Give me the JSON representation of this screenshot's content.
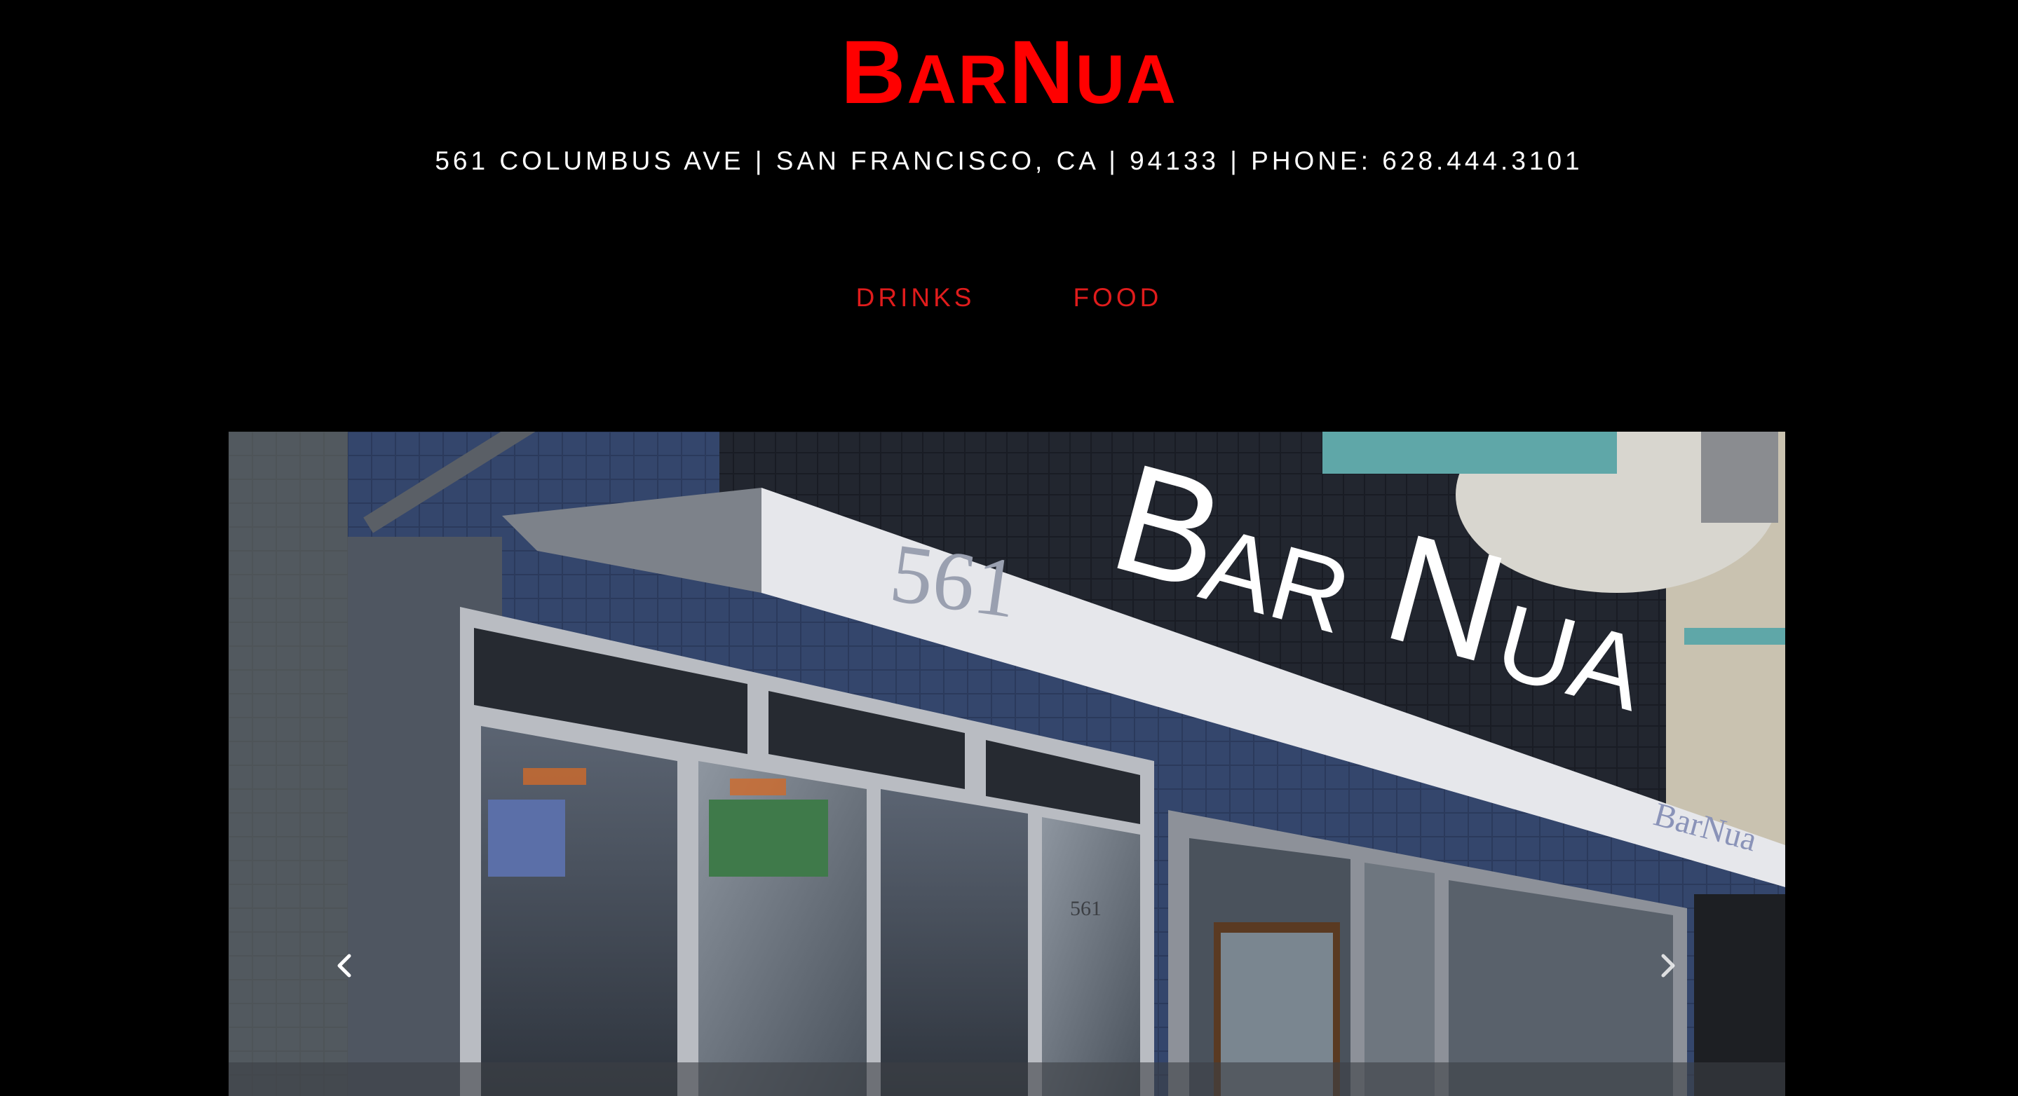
{
  "site": {
    "logo_first_big": "B",
    "logo_first_small": "AR",
    "logo_second_big": "N",
    "logo_second_small": "UA",
    "address": "561 COLUMBUS AVE | SAN FRANCISCO, CA | 94133 | PHONE: 628.444.3101"
  },
  "nav": {
    "items": [
      {
        "label": "DRINKS"
      },
      {
        "label": "FOOD"
      }
    ]
  },
  "slideshow": {
    "sign_number": "561",
    "sign_name_first_big": "B",
    "sign_name_first_small": "AR",
    "sign_name_second_big": "N",
    "sign_name_second_small": "UA",
    "awning_name": "BarNua",
    "door_number": "561",
    "prev_icon": "chevron-left-icon",
    "next_icon": "chevron-right-icon"
  },
  "colors": {
    "background": "#000000",
    "logo": "#ff0000",
    "nav_link": "#e01c1c",
    "address": "#ffffff"
  }
}
